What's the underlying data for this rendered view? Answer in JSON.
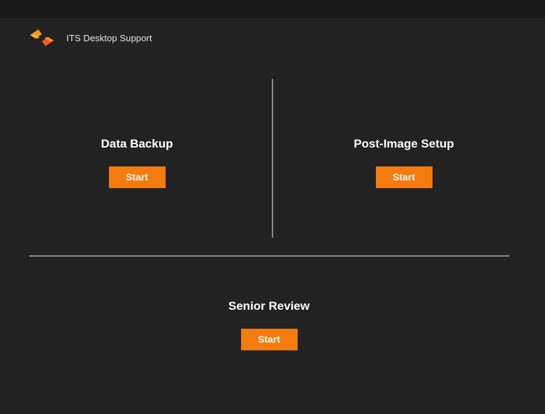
{
  "header": {
    "brand_name": "ITS Desktop Support",
    "logo_icon": "chevron-brackets-logo",
    "logo_colors": [
      "#f7931e",
      "#f15a24"
    ]
  },
  "colors": {
    "background": "#222222",
    "topbar": "#191919",
    "accent": "#f47b0e",
    "divider": "#8a8a8a"
  },
  "panels": [
    {
      "title": "Data Backup",
      "button_label": "Start"
    },
    {
      "title": "Post-Image Setup",
      "button_label": "Start"
    },
    {
      "title": "Senior Review",
      "button_label": "Start"
    }
  ]
}
